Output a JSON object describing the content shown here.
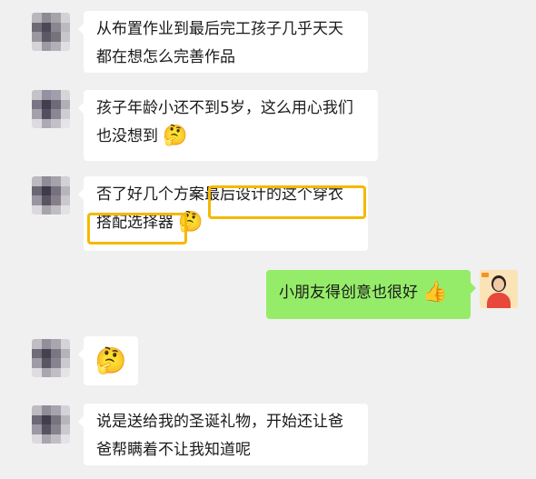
{
  "messages": [
    {
      "side": "left",
      "lines": [
        "从布置作业到最后完工孩子几乎天天",
        "都在想怎么完善作品"
      ]
    },
    {
      "side": "left",
      "lines": [
        "孩子年龄小还不到5岁，这么用心我们",
        "也没想到"
      ],
      "emoji": "🤔"
    },
    {
      "side": "left",
      "lines": [
        "否了好几个方案最后设计的这个穿衣",
        "搭配选择器"
      ],
      "emoji": "🤔"
    },
    {
      "side": "right",
      "lines": [
        "小朋友得创意也很好"
      ],
      "emoji": "👍"
    },
    {
      "side": "left",
      "lines": [],
      "emoji": "🤔"
    },
    {
      "side": "left",
      "lines": [
        "说是送给我的圣诞礼物，开始还让爸",
        "爸帮瞒着不让我知道呢"
      ]
    }
  ],
  "highlights": [
    "最后设计的这个穿衣",
    "搭配选择器"
  ],
  "colors": {
    "background": "#f0f0f0",
    "bubble_left": "#ffffff",
    "bubble_right": "#95ec69",
    "highlight": "#f5b800"
  }
}
